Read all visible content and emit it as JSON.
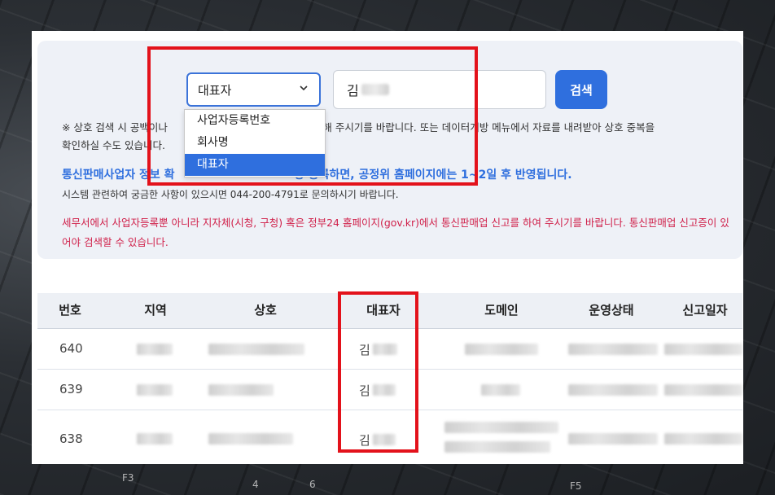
{
  "search": {
    "select_value": "대표자",
    "input_value": "김",
    "button_label": "검색",
    "options": [
      "사업자등록번호",
      "회사명",
      "대표자"
    ],
    "selected_index": 2
  },
  "notes": {
    "note1_a": "※ 상호 검색 시 공백이나",
    "note1_b": "여 입력해 주시기를 바랍니다. 또는 데이터개방 메뉴에서 자료를 내려받아 상호 중복을",
    "note1_c": "확인하실 수도 있습니다.",
    "note2_a": "통신판매사업자 정보 확",
    "note2_b": "경·등록하면, 공정위 홈페이지",
    "note2_c": "에는 1~2일 후 반영됩니다.",
    "note3": "시스템 관련하여 궁금한 사항이 있으시면 044-200-4791로 문의하시기 바랍니다.",
    "note4": "세무서에서 사업자등록뿐 아니라 지자체(시청, 구청) 혹은 정부24 홈페이지(gov.kr)에서 통신판매업 신고를 하여 주시기를 바랍니다. 통신판매업 신고증이 있어야 검색할 수 있습니다."
  },
  "table": {
    "headers": [
      "번호",
      "지역",
      "상호",
      "대표자",
      "도메인",
      "운영상태",
      "신고일자"
    ],
    "rows": [
      {
        "no": "640",
        "rep": "김"
      },
      {
        "no": "639",
        "rep": "김"
      },
      {
        "no": "638",
        "rep": "김"
      }
    ]
  },
  "background_keys": [
    "F3",
    "4",
    "6",
    "F5"
  ],
  "colors": {
    "accent": "#2f6fde",
    "highlight": "#e3121b",
    "warning": "#d0204a"
  }
}
